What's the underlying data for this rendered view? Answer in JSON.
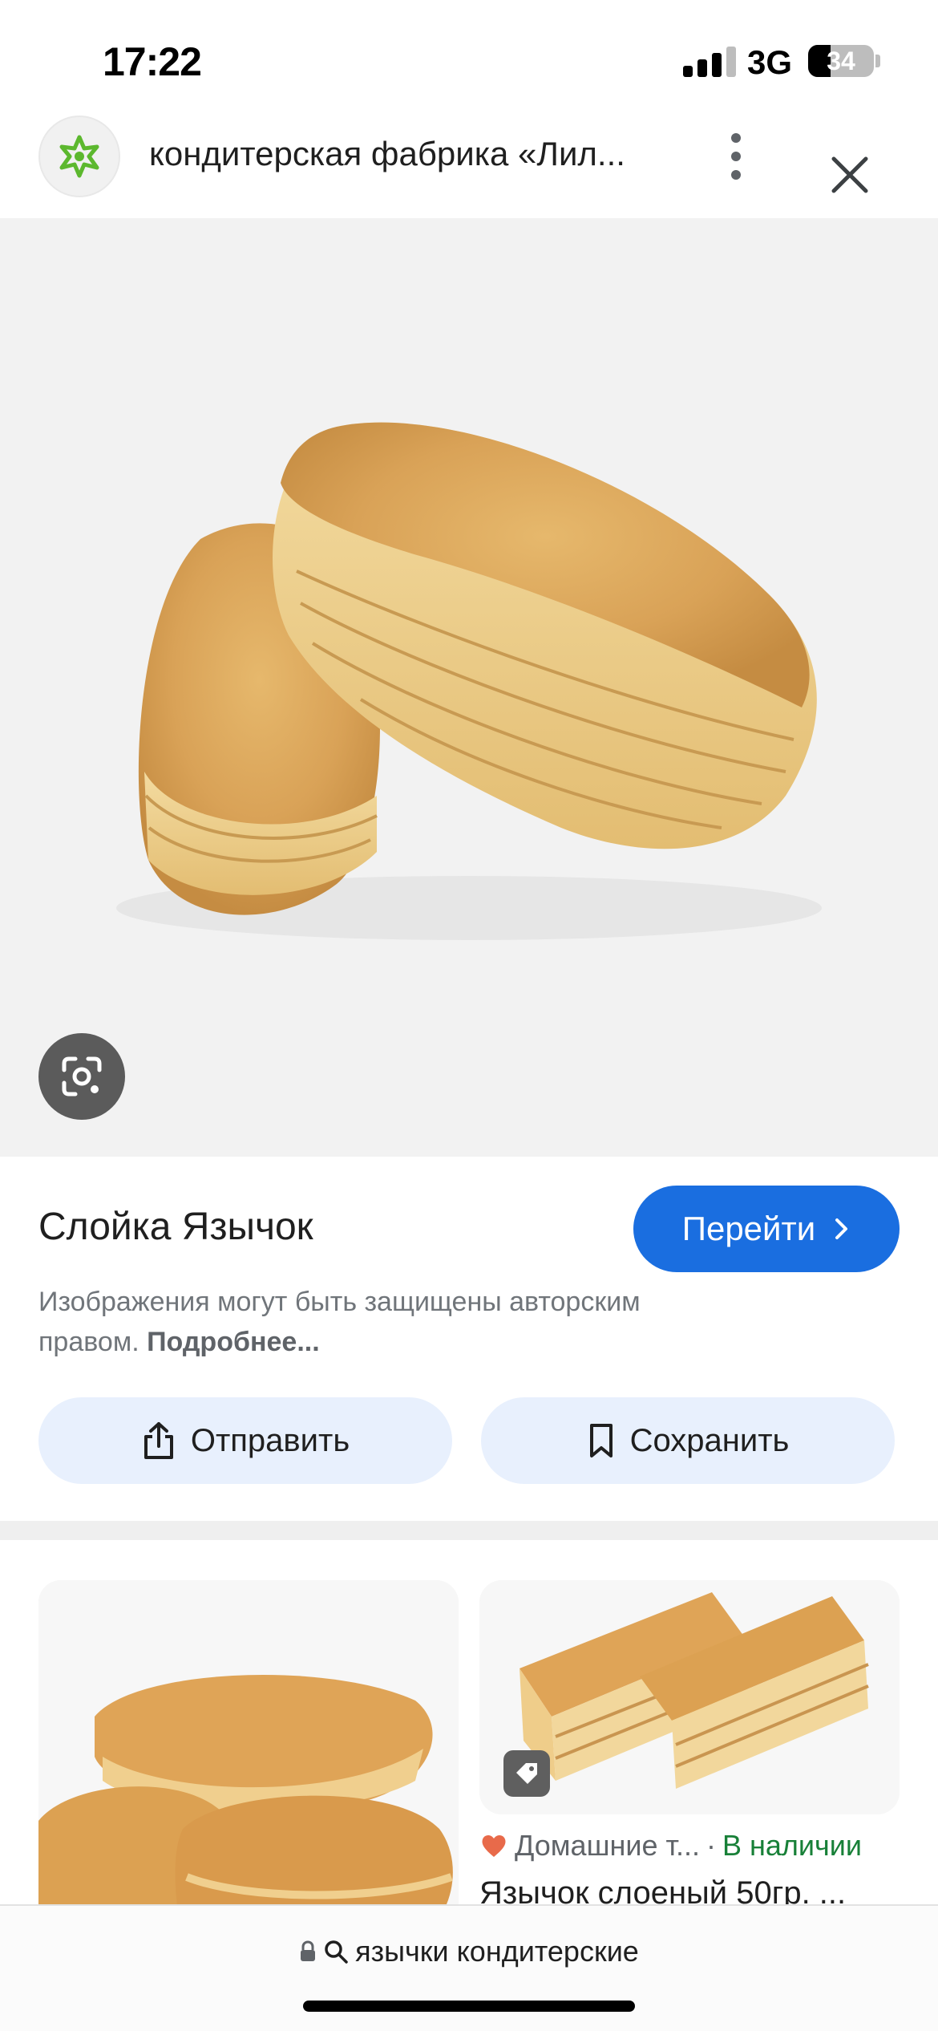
{
  "status_bar": {
    "time": "17:22",
    "network": "3G",
    "battery": "34",
    "battery_level": 0.34
  },
  "header": {
    "site_title": "кондитерская фабрика «Лил...",
    "logo_icon": "flower-logo-icon",
    "menu_icon": "more-vert-icon",
    "close_icon": "close-icon"
  },
  "hero": {
    "image_description": "pastry-photo",
    "lens_icon": "google-lens-icon"
  },
  "info": {
    "title": "Слойка Язычок",
    "visit_label": "Перейти",
    "copyright_text": "Изображения могут быть защищены авторским правом.",
    "more_link": "Подробнее...",
    "share_label": "Отправить",
    "save_label": "Сохранить"
  },
  "related": {
    "card2_source": "Домашние т...",
    "card2_separator": "·",
    "card2_stock": "В наличии",
    "card2_title": "Язычок слоеный 50гр. ..."
  },
  "url_bar": {
    "query": "язычки кондитерские"
  },
  "colors": {
    "accent": "#1a6ee0",
    "button_bg": "#e8f0fd",
    "stock_green": "#188038"
  }
}
